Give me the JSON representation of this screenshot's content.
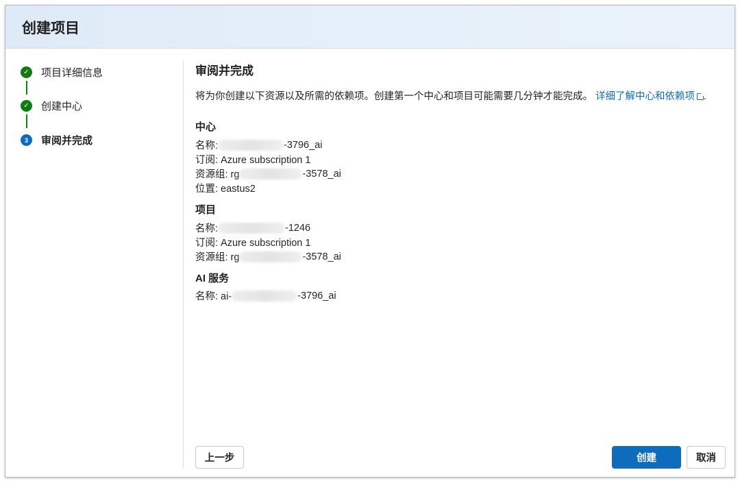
{
  "dialog": {
    "title": "创建项目"
  },
  "steps": [
    {
      "label": "项目详细信息",
      "status": "done"
    },
    {
      "label": "创建中心",
      "status": "done"
    },
    {
      "label": "审阅并完成",
      "status": "current",
      "number": "3"
    }
  ],
  "review": {
    "title": "审阅并完成",
    "intro": "将为你创建以下资源以及所需的依赖项。创建第一个中心和项目可能需要几分钟才能完成。",
    "learn_more_link": "详细了解中心和依赖项",
    "hub": {
      "heading": "中心",
      "name_label": "名称:",
      "name_suffix": "-3796_ai",
      "subscription": "订阅: Azure subscription 1",
      "resource_group_label": "资源组: rg",
      "resource_group_suffix": "-3578_ai",
      "location": "位置: eastus2"
    },
    "project": {
      "heading": "项目",
      "name_label": "名称:",
      "name_suffix": "-1246",
      "subscription": "订阅: Azure subscription 1",
      "resource_group_label": "资源组: rg",
      "resource_group_suffix": "-3578_ai"
    },
    "ai_services": {
      "heading": "AI 服务",
      "name_label": "名称: ai-",
      "name_suffix": "-3796_ai"
    }
  },
  "footer": {
    "back_label": "上一步",
    "create_label": "创建",
    "cancel_label": "取消"
  },
  "colors": {
    "accent": "#0f6cbd",
    "success": "#107c10",
    "header_bg": "#e6f0fa"
  },
  "icons": {
    "done": "checkmark-icon",
    "external_link": "external-link-icon"
  }
}
